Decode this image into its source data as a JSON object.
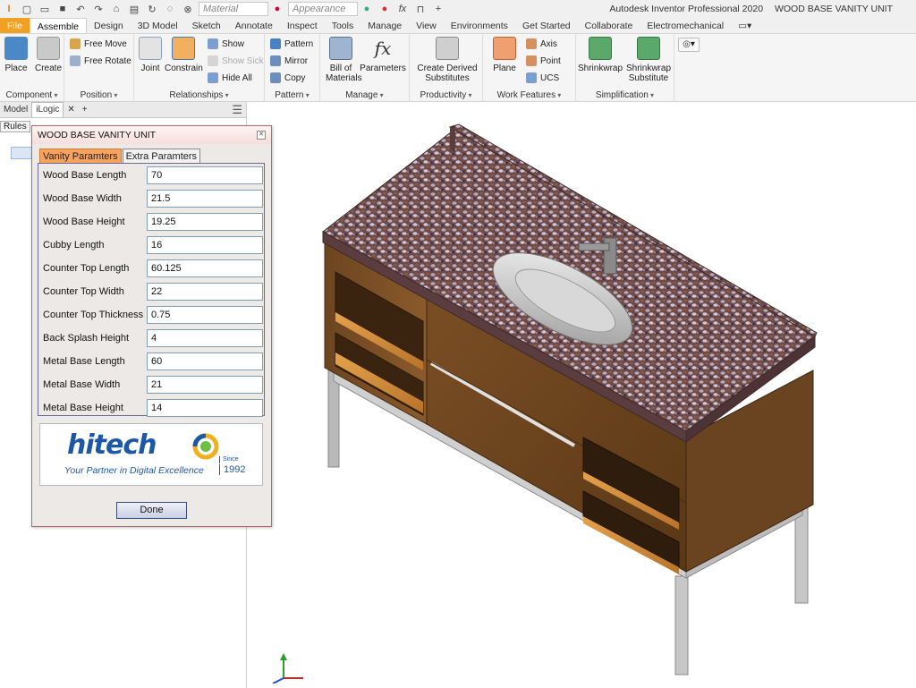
{
  "app": {
    "title": "Autodesk Inventor Professional 2020",
    "document": "WOOD BASE VANITY UNIT"
  },
  "quick_access": {
    "material_placeholder": "Material",
    "appearance_placeholder": "Appearance"
  },
  "ribbon_tabs": [
    "File",
    "Assemble",
    "Design",
    "3D Model",
    "Sketch",
    "Annotate",
    "Inspect",
    "Tools",
    "Manage",
    "View",
    "Environments",
    "Get Started",
    "Collaborate",
    "Electromechanical"
  ],
  "active_tab": "Assemble",
  "ribbon": {
    "component": {
      "label": "Component",
      "place": "Place",
      "create": "Create"
    },
    "position": {
      "label": "Position",
      "free_move": "Free Move",
      "free_rotate": "Free Rotate"
    },
    "relationships": {
      "label": "Relationships",
      "joint": "Joint",
      "constrain": "Constrain",
      "show": "Show",
      "show_sick": "Show Sick",
      "hide_all": "Hide All"
    },
    "pattern": {
      "label": "Pattern",
      "pattern": "Pattern",
      "mirror": "Mirror",
      "copy": "Copy"
    },
    "manage": {
      "label": "Manage",
      "bom_line1": "Bill of",
      "bom_line2": "Materials",
      "parameters": "Parameters"
    },
    "productivity": {
      "label": "Productivity",
      "create_derived_line1": "Create Derived",
      "create_derived_line2": "Substitutes"
    },
    "work_features": {
      "label": "Work Features",
      "plane": "Plane",
      "axis": "Axis",
      "point": "Point",
      "ucs": "UCS"
    },
    "simplification": {
      "label": "Simplification",
      "shrinkwrap": "Shrinkwrap",
      "shrinkwrap_sub_line1": "Shrinkwrap",
      "shrinkwrap_sub_line2": "Substitute"
    }
  },
  "browser": {
    "tabs": [
      "Model",
      "iLogic"
    ],
    "rules_label": "Rules"
  },
  "dialog": {
    "title": "WOOD BASE VANITY UNIT",
    "tabs": [
      "Vanity Paramters",
      "Extra Paramters"
    ],
    "active_tab": "Vanity Paramters",
    "parameters": [
      {
        "label": "Wood Base Length",
        "value": "70"
      },
      {
        "label": "Wood Base Width",
        "value": "21.5"
      },
      {
        "label": "Wood Base Height",
        "value": "19.25"
      },
      {
        "label": "Cubby Length",
        "value": "16"
      },
      {
        "label": "Counter Top Length",
        "value": "60.125"
      },
      {
        "label": "Counter Top Width",
        "value": "22"
      },
      {
        "label": "Counter Top Thickness",
        "value": "0.75"
      },
      {
        "label": "Back Splash Height",
        "value": "4"
      },
      {
        "label": "Metal Base Length",
        "value": "60"
      },
      {
        "label": "Metal Base Width",
        "value": "21"
      },
      {
        "label": "Metal Base Height",
        "value": "14"
      }
    ],
    "logo": {
      "word": "hitech",
      "tagline": "Your Partner in Digital Excellence",
      "since": "Since",
      "year": "1992"
    },
    "done_label": "Done"
  },
  "colors": {
    "file_tab": "#f2a024",
    "dialog_tab_active": "#f7a25e",
    "logo_blue": "#1d57a8",
    "wood": "#8a5a2b",
    "granite": "#6e4a4a"
  }
}
